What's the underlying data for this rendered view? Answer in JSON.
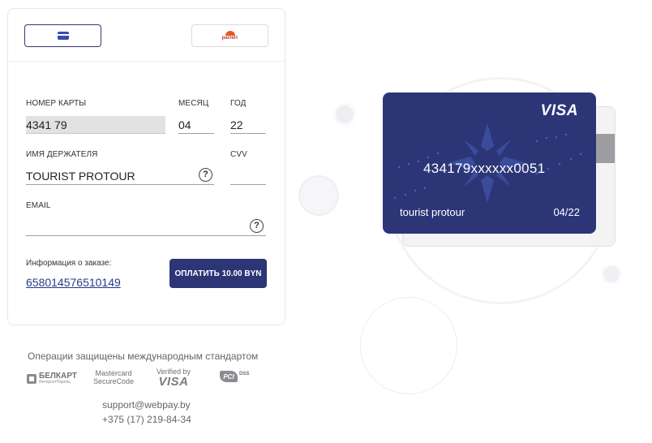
{
  "payment_tabs": {
    "card_icon": "credit-card-icon",
    "raschet_icon": "raschet-logo-icon",
    "raschet_label": "расчет"
  },
  "form": {
    "card_number_label": "НОМЕР КАРТЫ",
    "card_number_value": "4341 79",
    "month_label": "МЕСЯЦ",
    "month_value": "04",
    "year_label": "ГОД",
    "year_value": "22",
    "holder_label": "ИМЯ ДЕРЖАТЕЛЯ",
    "holder_value": "TOURIST PROTOUR",
    "cvv_label": "CVV",
    "cvv_value": "",
    "email_label": "EMAIL",
    "email_value": "",
    "help_glyph": "?"
  },
  "order": {
    "label": "Информация о заказе:",
    "number": "658014576510149",
    "pay_button": "ОПЛАТИТЬ 10.00 BYN"
  },
  "footer": {
    "secure_text": "Операции защищены международным стандартом",
    "belkart_name": "БЕЛКАРТ",
    "belkart_sub": "ИнтернэтПароль",
    "mastercard_line1": "Mastercard",
    "mastercard_line2": "SecureCode",
    "verified_by": "Verified by",
    "visa": "VISA",
    "pci": "PCI",
    "dss": "DSS",
    "support_email": "support@webpay.by",
    "support_phone": "+375 (17) 219-84-34"
  },
  "card_preview": {
    "brand": "VISA",
    "number": "434179xxxxxx0051",
    "holder": "tourist protour",
    "expiry": "04/22"
  },
  "colors": {
    "primary": "#2c3677",
    "link": "#283a86",
    "card_bg": "#2c3677"
  }
}
